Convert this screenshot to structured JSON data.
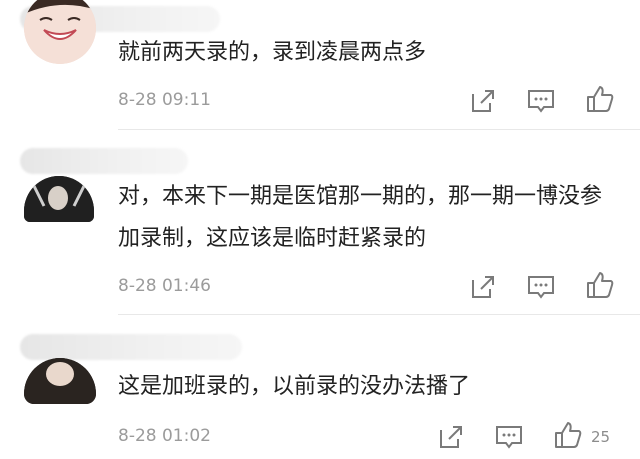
{
  "comments": [
    {
      "text": "就前两天录的，录到凌晨两点多",
      "time": "8-28 09:11",
      "likes": ""
    },
    {
      "text": "对，本来下一期是医馆那一期的，那一期一博没参加录制，这应该是临时赶紧录的",
      "time": "8-28 01:46",
      "likes": ""
    },
    {
      "text": "这是加班录的，以前录的没办法播了",
      "time": "8-28 01:02",
      "likes": "25"
    }
  ],
  "icons": {
    "share": "share-icon",
    "comment": "comment-icon",
    "like": "thumbs-up-icon"
  },
  "colors": {
    "text": "#222222",
    "meta": "#9b9b9b",
    "icon": "#7a7a7a",
    "divider": "#e8e8e8"
  }
}
